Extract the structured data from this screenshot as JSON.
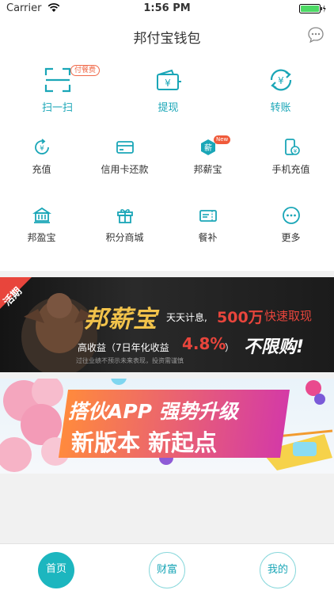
{
  "status_bar": {
    "carrier": "Carrier",
    "time": "1:56 PM"
  },
  "nav": {
    "title": "邦付宝钱包",
    "message_icon": "chat-bubble-icon"
  },
  "grid": {
    "main": [
      {
        "label": "扫一扫",
        "icon": "scan-icon",
        "badge": "付餐费"
      },
      {
        "label": "提现",
        "icon": "withdraw-icon"
      },
      {
        "label": "转账",
        "icon": "transfer-icon"
      }
    ],
    "row2": [
      {
        "label": "充值",
        "icon": "recharge-icon"
      },
      {
        "label": "信用卡还款",
        "icon": "credit-card-icon"
      },
      {
        "label": "邦薪宝",
        "icon": "salary-treasure-icon",
        "badge": "New"
      },
      {
        "label": "手机充值",
        "icon": "phone-recharge-icon"
      }
    ],
    "row3": [
      {
        "label": "邦盈宝",
        "icon": "bank-icon"
      },
      {
        "label": "积分商城",
        "icon": "gift-icon"
      },
      {
        "label": "餐补",
        "icon": "meal-ticket-icon"
      },
      {
        "label": "更多",
        "icon": "more-icon"
      }
    ]
  },
  "banner1": {
    "ribbon": "活期",
    "brand": "邦薪宝",
    "slogan": "天天计息,",
    "amount": "500万",
    "amount_suffix": "快速取现",
    "yield_label": "高收益（7日年化收益",
    "yield_value": "4.8%",
    "yield_close": "）",
    "unlimited": "不限购!",
    "disclaimer": "过往业绩不预示未来表现，投资需谨慎"
  },
  "banner2": {
    "line1": "搭伙APP 强势升级",
    "line2": "新版本 新起点"
  },
  "tabs": [
    {
      "label": "首页",
      "active": true
    },
    {
      "label": "财富",
      "active": false
    },
    {
      "label": "我的",
      "active": false
    }
  ],
  "colors": {
    "accent": "#1cb6bf",
    "badge_red": "#f05a3a",
    "banner_red": "#e8453c",
    "banner_gold": "#f2c34b"
  }
}
